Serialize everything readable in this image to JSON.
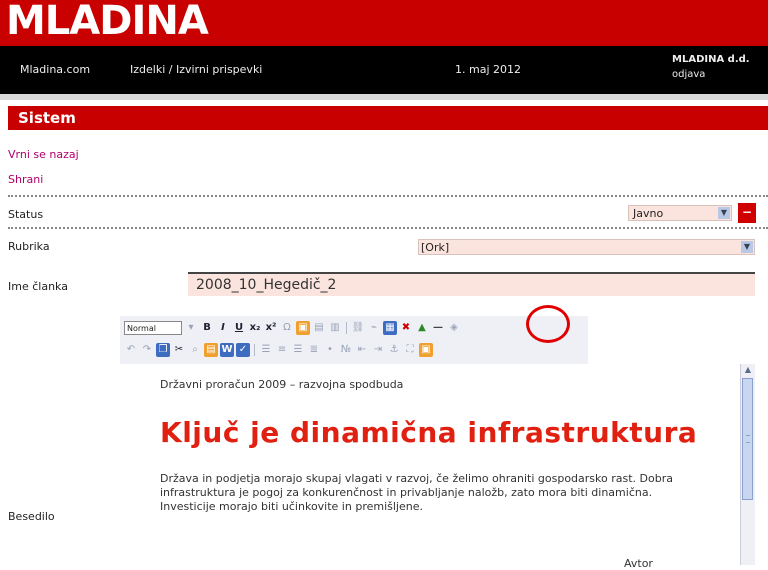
{
  "header": {
    "logo": "MLADINA"
  },
  "nav": {
    "link_a": "Mladina.com",
    "link_b": "Izdelki / Izvirni prispevki",
    "date": "1. maj 2012",
    "user_name": "MLADINA d.d.",
    "user_action": "odjava"
  },
  "section": {
    "title": "Sistem"
  },
  "links": {
    "back": "Vrni se nazaj",
    "save": "Shrani"
  },
  "form": {
    "status_label": "Status",
    "status_value": "Javno",
    "rubric_label": "Rubrika",
    "rubric_value": "[Ork]",
    "name_label": "Ime članka",
    "name_value": "2008_10_Hegedič_2",
    "text_label": "Besedilo"
  },
  "toolbar": {
    "format_select": "Normal"
  },
  "editor": {
    "small_line": "Državni proračun 2009 – razvojna spodbuda",
    "heading": "Ključ je dinamična infrastruktura",
    "body": "Država in podjetja morajo skupaj vlagati v razvoj, če želimo ohraniti gospodarsko rast. Dobra infrastruktura je pogoj za konkurenčnost in privabljanje naložb, zato mora biti dinamična. Investicije morajo biti učinkovite in premišljene.",
    "sign": "Avtor"
  },
  "colors": {
    "brand": "#c80000",
    "annotation": "#e00000",
    "heading": "#e02010"
  }
}
